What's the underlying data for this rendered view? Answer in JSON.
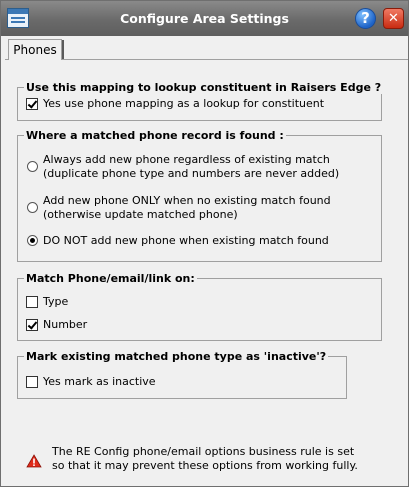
{
  "window": {
    "title": "Configure Area Settings",
    "help_label": "?",
    "close_label": "✕",
    "icons": [
      "app-icon",
      "help-icon",
      "close-icon"
    ]
  },
  "tabs": [
    {
      "label": "Phones",
      "active": true
    }
  ],
  "groups": {
    "lookup": {
      "title": "Use this mapping to lookup constituent in Raisers Edge ?",
      "option": {
        "label": "Yes use phone mapping as a lookup for constituent",
        "checked": true
      }
    },
    "matched": {
      "title": "Where a matched phone record is found :",
      "options": [
        {
          "line1": "Always add new phone regardless of existing match",
          "line2": "(duplicate phone type and numbers are never added)",
          "selected": false
        },
        {
          "line1": "Add new phone ONLY when no existing match found",
          "line2": "(otherwise update matched phone)",
          "selected": false
        },
        {
          "line1": "DO NOT add new phone when existing match found",
          "selected": true
        }
      ]
    },
    "match_on": {
      "title": "Match Phone/email/link on:",
      "options": [
        {
          "label": "Type",
          "checked": false
        },
        {
          "label": "Number",
          "checked": true
        }
      ]
    },
    "inactive": {
      "title": "Mark existing matched phone type as 'inactive'?",
      "option": {
        "label": "Yes mark as inactive",
        "checked": false
      }
    }
  },
  "warning": {
    "icon": "warning-icon",
    "line1": "The RE Config phone/email options business rule is set",
    "line2": "so that it may prevent these options from working fully."
  }
}
